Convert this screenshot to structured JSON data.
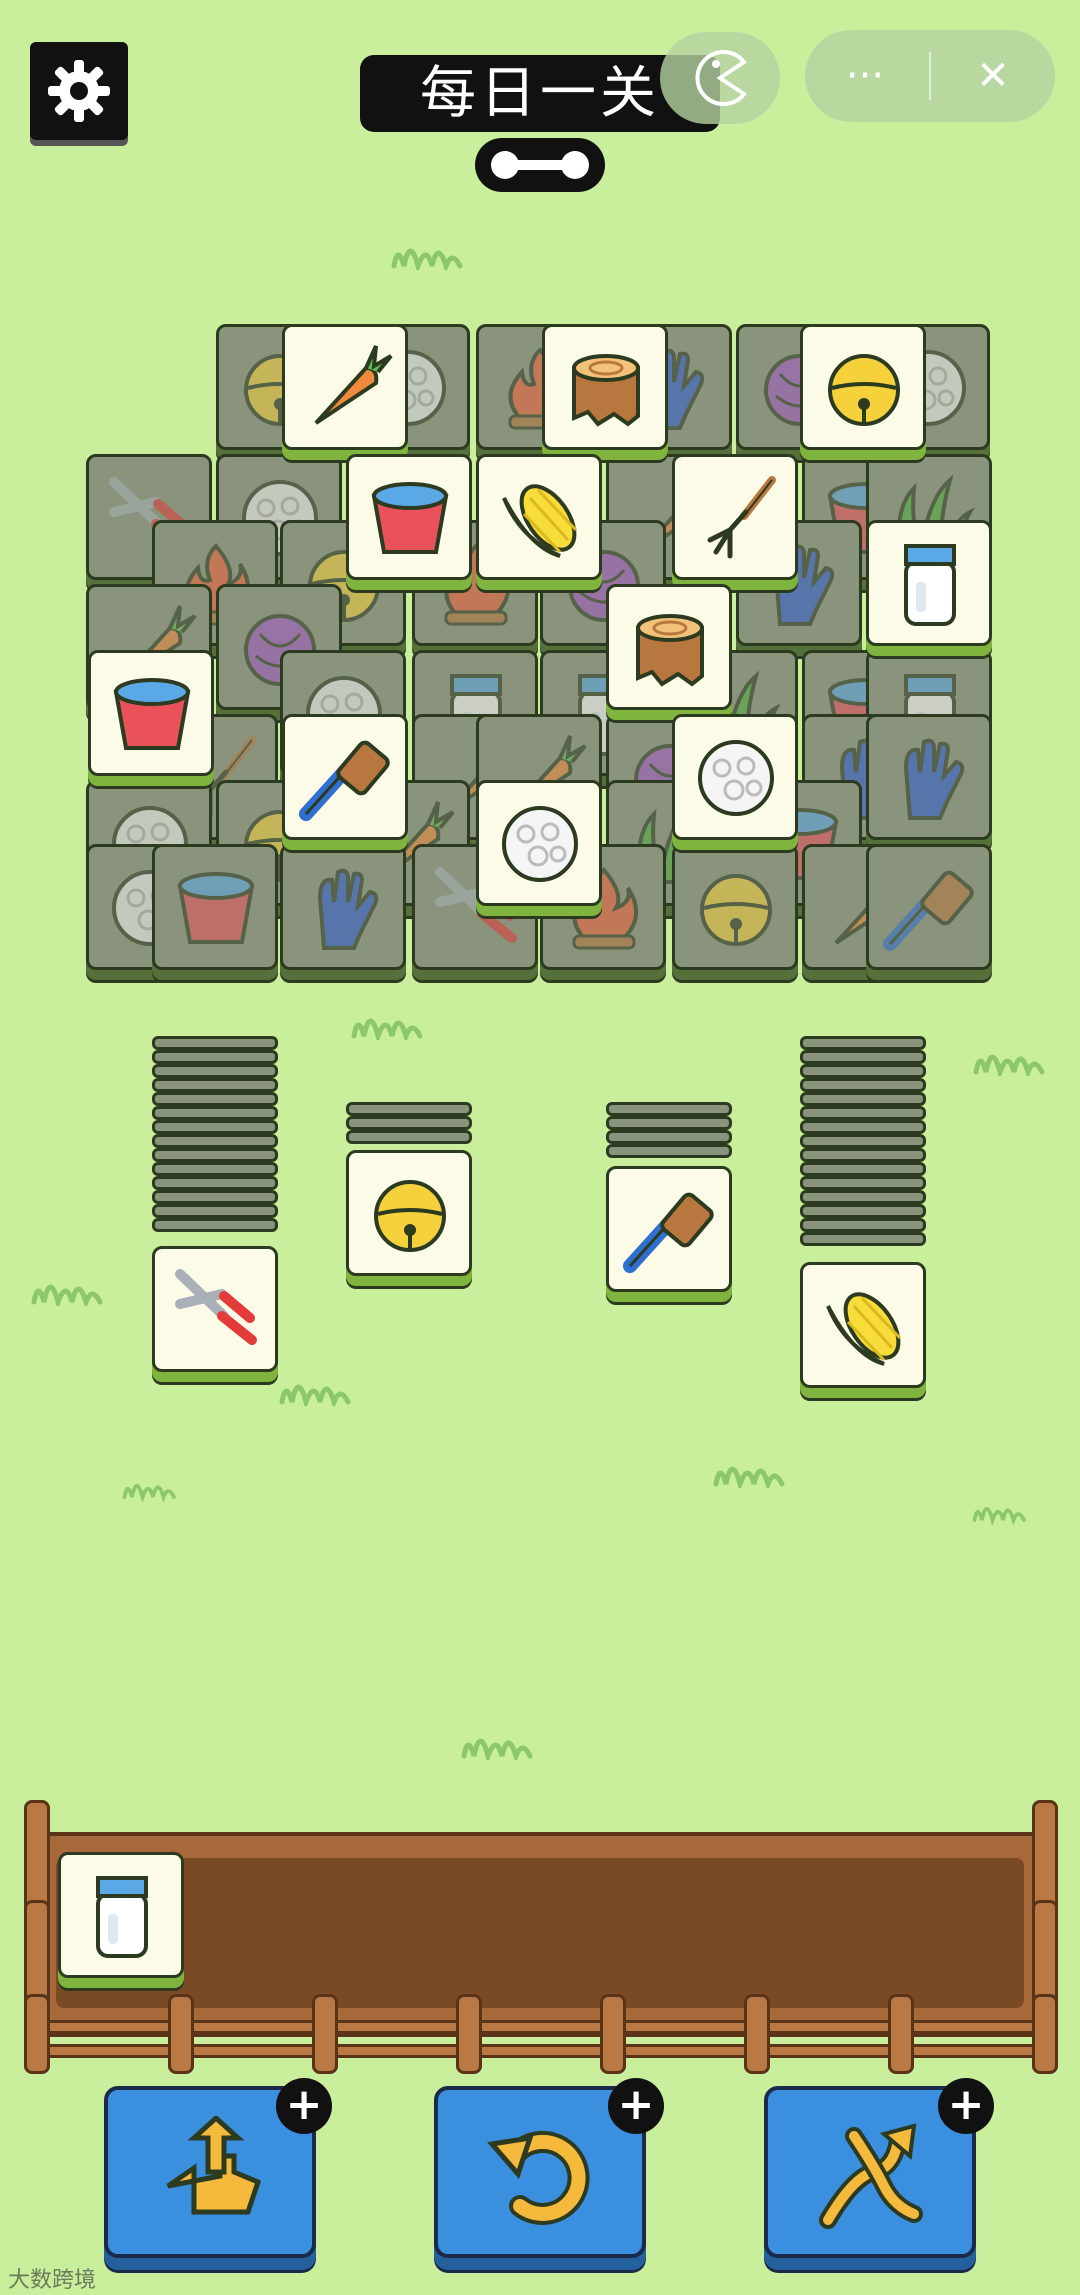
{
  "header": {
    "title": "每日一关",
    "settings_icon": "gear-icon",
    "capsule_more": "···",
    "capsule_close": "✕"
  },
  "board": {
    "layers": 3,
    "top_tiles": [
      "carrot",
      "tree-stump",
      "golden-bell",
      "water-bucket",
      "corn",
      "garden-fork",
      "milk-jar",
      "tree-stump",
      "water-bucket",
      "blue-brush",
      "cotton-ball",
      "cotton-ball"
    ]
  },
  "piles": [
    {
      "top": "pruning-shears"
    },
    {
      "top": "golden-bell"
    },
    {
      "top": "blue-brush"
    },
    {
      "top": "corn"
    }
  ],
  "tray": {
    "slots": 7,
    "tiles": [
      "milk-jar"
    ]
  },
  "toolbar": [
    {
      "name": "move-out",
      "icon": "hand-arrow-icon"
    },
    {
      "name": "undo",
      "icon": "undo-arrow-icon"
    },
    {
      "name": "shuffle",
      "icon": "shuffle-icon"
    }
  ],
  "watermark": "大数跨境",
  "colors": {
    "background": "#c9ef9c",
    "tile_face": "#fbfbe8",
    "tile_edge": "#7fb43e",
    "button": "#3a8fde",
    "fence": "#a8693a"
  }
}
